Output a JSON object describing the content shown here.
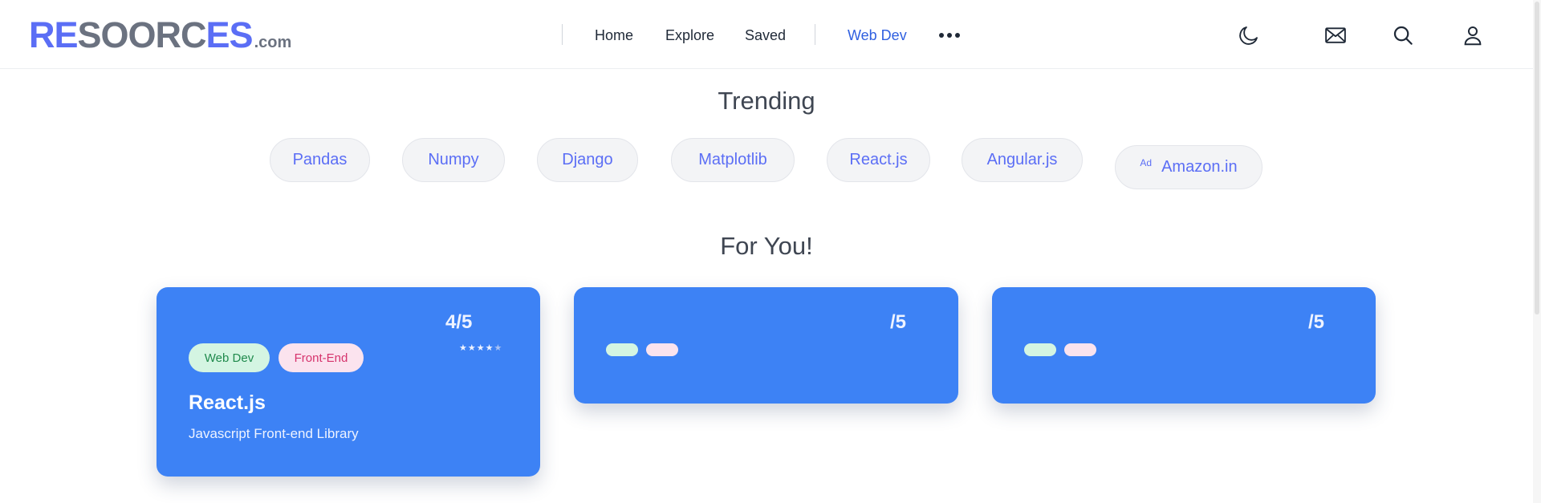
{
  "logo": {
    "part1": "RE",
    "part2": "SOORC",
    "part3": "ES",
    "suffix": ".com"
  },
  "nav": {
    "items": [
      {
        "label": "Home"
      },
      {
        "label": "Explore"
      },
      {
        "label": "Saved"
      },
      {
        "label": "Web Dev",
        "active": true
      }
    ],
    "more_icon": "ellipsis-icon"
  },
  "header_icons": [
    "moon-icon",
    "mail-icon",
    "search-icon",
    "user-icon"
  ],
  "trending": {
    "title": "Trending",
    "pills": [
      "Pandas",
      "Numpy",
      "Django",
      "Matplotlib",
      "React.js",
      "Angular.js"
    ],
    "ad": {
      "badge": "Ad",
      "label": "Amazon.in"
    }
  },
  "for_you": {
    "title": "For You!",
    "cards": [
      {
        "score": "4/5",
        "rating": 4,
        "max_rating": 5,
        "tags": [
          "Web Dev",
          "Front-End"
        ],
        "title": "React.js",
        "description": "Javascript Front-end Library"
      },
      {
        "score": "/5"
      },
      {
        "score": "/5"
      }
    ]
  },
  "colors": {
    "accent": "#5b6ef5",
    "card": "#3d82f5",
    "nav_active": "#2f5fe0"
  }
}
